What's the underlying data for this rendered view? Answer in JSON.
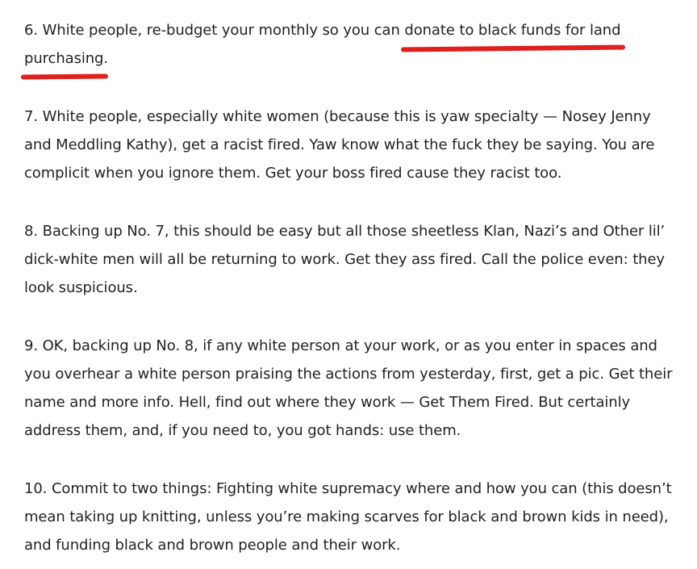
{
  "paragraphs": [
    {
      "lines": [
        {
          "before": "6. White people, re-budget your monthly so you can ",
          "highlight": "donate to black funds for land"
        },
        {
          "highlight": "purchasing",
          "after": "."
        }
      ]
    },
    {
      "lines": [
        {
          "text": "7. White people, especially white women (because this is yaw specialty — Nosey Jenny"
        },
        {
          "text": "and Meddling Kathy), get a racist fired. Yaw know what the fuck they be saying. You are"
        },
        {
          "text": "complicit when you ignore them. Get your boss fired cause they racist too."
        }
      ]
    },
    {
      "lines": [
        {
          "text": "8. Backing up No. 7, this should be easy but all those sheetless Klan, Nazi’s and Other lil’"
        },
        {
          "text": "dick-white men will all be returning to work. Get they ass fired. Call the police even: they"
        },
        {
          "text": "look suspicious."
        }
      ]
    },
    {
      "lines": [
        {
          "text": "9. OK, backing up No. 8, if any white person at your work, or as you enter in spaces and"
        },
        {
          "text": "you overhear a white person praising the actions from yesterday, first, get a pic. Get their"
        },
        {
          "text": "name and more info. Hell, find out where they work — Get Them Fired. But certainly"
        },
        {
          "text": "address them, and, if you need to, you got hands: use them."
        }
      ]
    },
    {
      "lines": [
        {
          "text": "10. Commit to two things: Fighting white supremacy where and how you can (this doesn’t"
        },
        {
          "text": "mean taking up knitting, unless you’re making scarves for black and brown kids in need),"
        },
        {
          "text": "and funding black and brown people and their work."
        }
      ]
    }
  ],
  "colors": {
    "text": "#222222",
    "underline": "#e0201c",
    "background": "#ffffff"
  }
}
